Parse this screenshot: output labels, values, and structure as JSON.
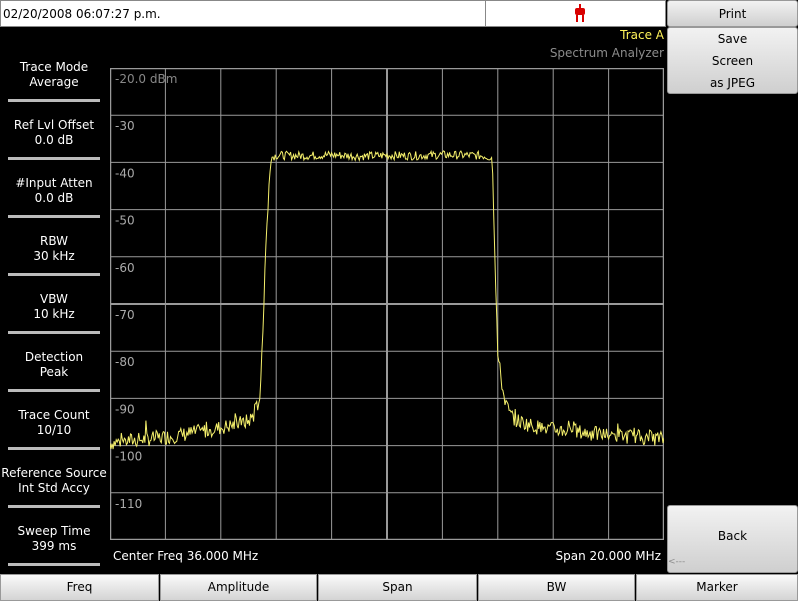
{
  "status_bar": {
    "datetime": "02/20/2008 06:07:27 p.m."
  },
  "colors": {
    "trace": "#f5f06c",
    "grid": "#9a9a9a",
    "accent_power": "#d80000"
  },
  "header": {
    "trace_label": "Trace A",
    "mode_label": "Spectrum Analyzer"
  },
  "left_panel": [
    {
      "title": "Trace Mode",
      "value": "Average"
    },
    {
      "title": "Ref Lvl Offset",
      "value": "0.0 dB"
    },
    {
      "title": "#Input Atten",
      "value": "0.0 dB"
    },
    {
      "title": "RBW",
      "value": "30 kHz"
    },
    {
      "title": "VBW",
      "value": "10 kHz"
    },
    {
      "title": "Detection",
      "value": "Peak"
    },
    {
      "title": "Trace Count",
      "value": "10/10"
    },
    {
      "title": "Reference Source",
      "value": "Int Std Accy"
    },
    {
      "title": "Sweep Time",
      "value": "399 ms"
    }
  ],
  "softkeys": {
    "print": "Print",
    "save_line1": "Save",
    "save_line2": "Screen",
    "save_line3": "as JPEG",
    "back": "Back"
  },
  "bottom_menu": [
    "Freq",
    "Amplitude",
    "Span",
    "BW",
    "Marker"
  ],
  "plot_footer": {
    "center": "Center Freq 36.000 MHz",
    "span": "Span 20.000 MHz"
  },
  "chart_data": {
    "type": "line",
    "y_ticks": [
      "-20.0 dBm",
      "-30",
      "-40",
      "-50",
      "-60",
      "-70",
      "-80",
      "-90",
      "-100",
      "-110"
    ],
    "ylim": [
      -120,
      -20
    ],
    "xlim": [
      26,
      46
    ],
    "grid": true,
    "series": [
      {
        "x": [
          26,
          26.5,
          27,
          27.5,
          28,
          28.5,
          29,
          29.5,
          30,
          30.5,
          31,
          31.2,
          31.4,
          31.5,
          31.6,
          31.8,
          32,
          33,
          34,
          35,
          36,
          37,
          38,
          39,
          39.5,
          39.8,
          39.9,
          40.0,
          40.2,
          40.4,
          40.6,
          41,
          41.5,
          42,
          42.5,
          43,
          43.5,
          44,
          44.5,
          45,
          45.5,
          46
        ],
        "values": [
          -99.5,
          -99,
          -98.8,
          -98.5,
          -98.2,
          -97.8,
          -97.3,
          -96.8,
          -96.2,
          -95.6,
          -94.8,
          -93.5,
          -90,
          -80,
          -60,
          -39,
          -38.5,
          -38.6,
          -38.4,
          -38.7,
          -38.5,
          -38.6,
          -38.4,
          -38.5,
          -38.6,
          -39,
          -60,
          -81,
          -89,
          -93,
          -94.5,
          -95.3,
          -96.2,
          -96.6,
          -96.8,
          -97.2,
          -97.5,
          -97.8,
          -98.0,
          -98.1,
          -98.3,
          -98.6
        ]
      }
    ]
  }
}
